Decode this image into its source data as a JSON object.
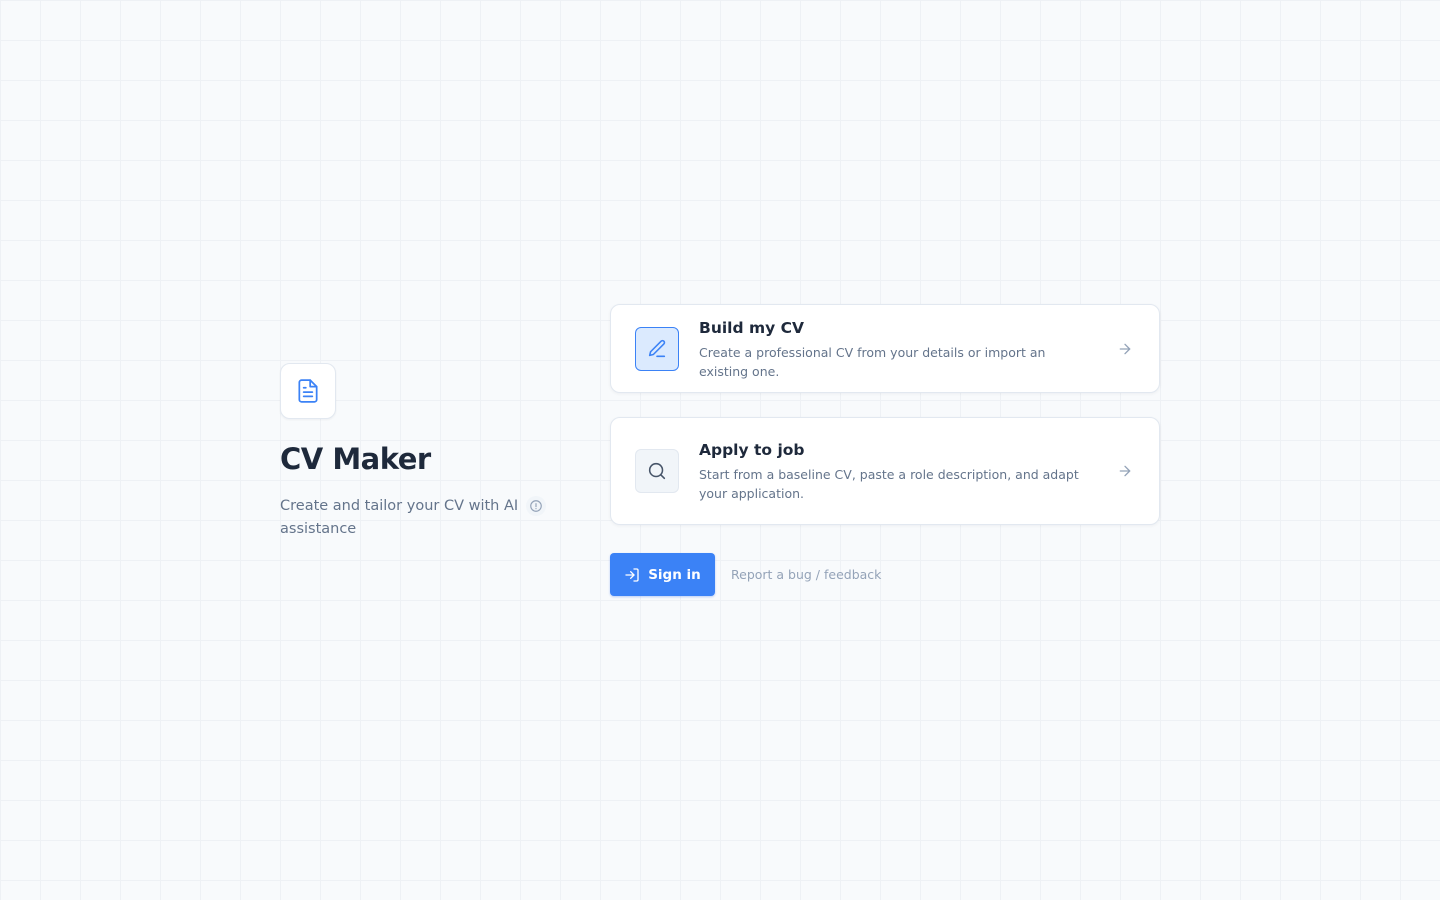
{
  "brand": {
    "logo_icon": "document-icon",
    "title": "CV Maker",
    "subtitle": "Create and tailor your CV with AI assistance",
    "info_icon": "info-icon"
  },
  "cards": [
    {
      "icon": "pencil-icon",
      "title": "Build my CV",
      "description": "Create a professional CV from your details or import an existing one.",
      "arrow_icon": "arrow-right-icon"
    },
    {
      "icon": "search-icon",
      "title": "Apply to job",
      "description": "Start from a baseline CV, paste a role description, and adapt your application.",
      "arrow_icon": "arrow-right-icon"
    }
  ],
  "actions": {
    "sign_in_label": "Sign in",
    "sign_in_icon": "sign-in-icon",
    "report_label": "Report a bug / feedback"
  },
  "colors": {
    "accent": "#3b82f6",
    "background": "#f8fafc",
    "text_primary": "#1e293b",
    "text_secondary": "#64748b"
  }
}
